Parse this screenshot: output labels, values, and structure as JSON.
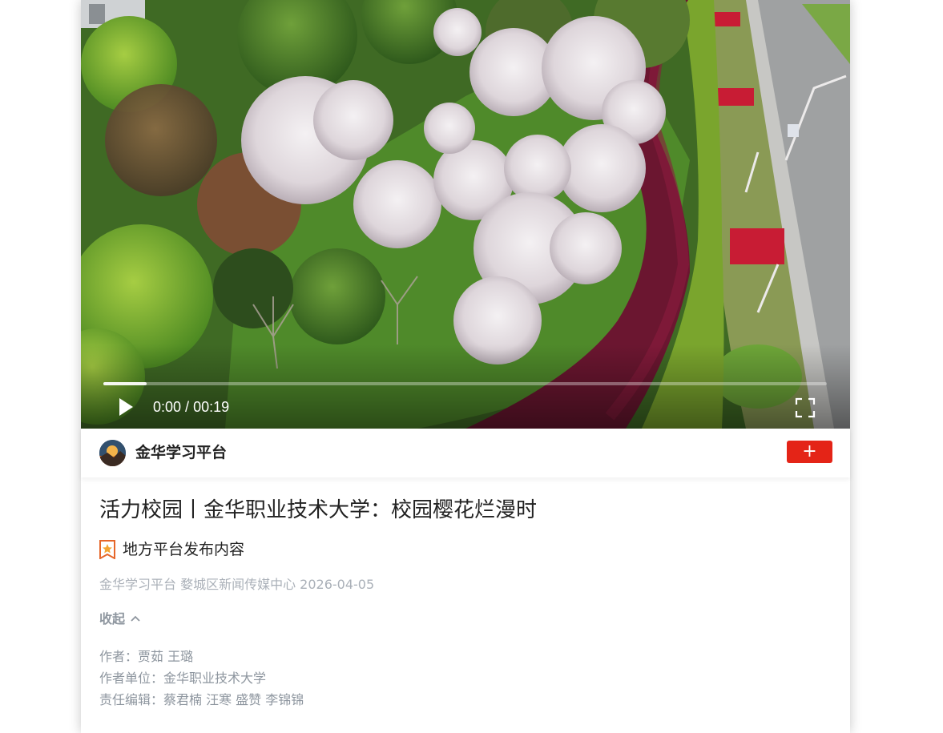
{
  "video": {
    "time_current": "0:00",
    "time_separator": " / ",
    "time_total": "00:19",
    "progress_fraction": 0.06,
    "play_icon": "play-icon",
    "fullscreen_icon": "fullscreen-icon"
  },
  "channel": {
    "name": "金华学习平台",
    "follow_label": "+",
    "accent_color": "#e42417"
  },
  "article": {
    "title": "活力校园丨金华职业技术大学：校园樱花烂漫时",
    "badge_icon": "star-badge-icon",
    "badge_text": "地方平台发布内容",
    "meta": "金华学习平台 婺城区新闻传媒中心 2026-04-05",
    "collapse_label": "收起",
    "credits": {
      "author": "作者：贾茹 王璐",
      "author_unit": "作者单位：金华职业技术大学",
      "editors": "责任编辑：蔡君楠 汪寒 盛赞 李锦锦"
    }
  }
}
